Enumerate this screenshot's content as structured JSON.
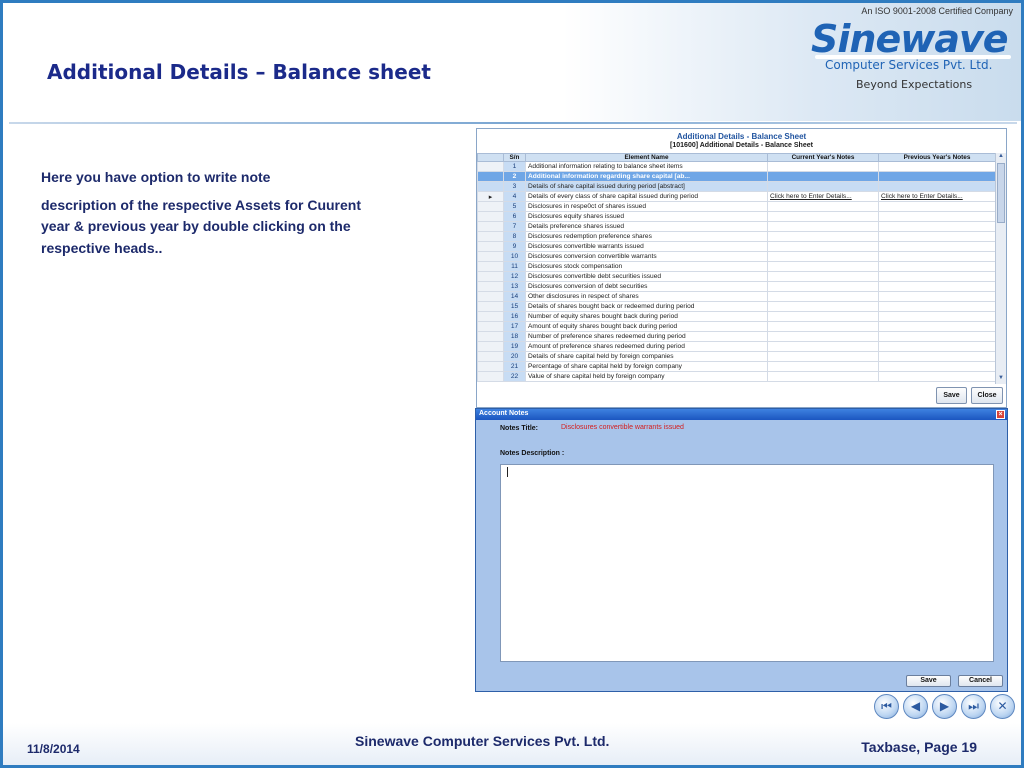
{
  "header": {
    "title": "Additional Details – Balance sheet",
    "iso": "An ISO 9001-2008 Certified Company",
    "logo_word": "Sinewave",
    "logo_sub": "Computer Services Pvt. Ltd.",
    "logo_tag": "Beyond Expectations"
  },
  "description": {
    "line1": "Here you have  option to write note",
    "line2": "description of the respective Assets for Cuurent year & previous year by double clicking on the respective heads.."
  },
  "grid_window": {
    "title": "Additional Details -  Balance Sheet",
    "subtitle": "[101600] Additional Details -  Balance Sheet",
    "columns": [
      "S/n",
      "Element Name",
      "Current Year's Notes",
      "Previous Year's Notes"
    ],
    "rows": [
      {
        "sn": "1",
        "name": "Additional information relating to balance sheet items",
        "cur": "",
        "prev": ""
      },
      {
        "sn": "2",
        "name": "Additional information regarding share capital [ab...",
        "cur": "",
        "prev": ""
      },
      {
        "sn": "3",
        "name": "Details of share capital issued during period [abstract]",
        "cur": "",
        "prev": ""
      },
      {
        "sn": "4",
        "name": "Details of every class of share capital issued during period",
        "cur": "Click here to Enter Details...",
        "prev": "Click here to Enter Details..."
      },
      {
        "sn": "5",
        "name": "Disclosures in respe0ct of shares issued",
        "cur": "",
        "prev": ""
      },
      {
        "sn": "6",
        "name": "Disclosures equity shares issued",
        "cur": "",
        "prev": ""
      },
      {
        "sn": "7",
        "name": "Details preference shares issued",
        "cur": "",
        "prev": ""
      },
      {
        "sn": "8",
        "name": "Disclosures redemption preference shares",
        "cur": "",
        "prev": ""
      },
      {
        "sn": "9",
        "name": "Disclosures convertible warrants issued",
        "cur": "",
        "prev": ""
      },
      {
        "sn": "10",
        "name": "Disclosures conversion convertible warrants",
        "cur": "",
        "prev": ""
      },
      {
        "sn": "11",
        "name": "Disclosures stock compensation",
        "cur": "",
        "prev": ""
      },
      {
        "sn": "12",
        "name": "Disclosures convertible debt securities issued",
        "cur": "",
        "prev": ""
      },
      {
        "sn": "13",
        "name": "Disclosures conversion of debt securities",
        "cur": "",
        "prev": ""
      },
      {
        "sn": "14",
        "name": "Other disclosures in respect of shares",
        "cur": "",
        "prev": ""
      },
      {
        "sn": "15",
        "name": "Details of shares bought back or redeemed during period",
        "cur": "",
        "prev": ""
      },
      {
        "sn": "16",
        "name": "Number of equity shares bought back during period",
        "cur": "",
        "prev": ""
      },
      {
        "sn": "17",
        "name": "Amount of equity shares bought back during period",
        "cur": "",
        "prev": ""
      },
      {
        "sn": "18",
        "name": "Number of preference shares redeemed during period",
        "cur": "",
        "prev": ""
      },
      {
        "sn": "19",
        "name": "Amount of preference shares redeemed during period",
        "cur": "",
        "prev": ""
      },
      {
        "sn": "20",
        "name": "Details of share capital held by foreign companies",
        "cur": "",
        "prev": ""
      },
      {
        "sn": "21",
        "name": "Percentage of share capital held by foreign company",
        "cur": "",
        "prev": ""
      },
      {
        "sn": "22",
        "name": "Value of share capital held by foreign company",
        "cur": "",
        "prev": ""
      }
    ],
    "save_label": "Save",
    "close_label": "Close"
  },
  "notes_dialog": {
    "title": "Account Notes",
    "notes_title_label": "Notes Title:",
    "notes_title_value": "Disclosures convertible warrants issued",
    "notes_desc_label": "Notes Description :",
    "save_label": "Save",
    "cancel_label": "Cancel"
  },
  "footer": {
    "date": "11/8/2014",
    "company": "Sinewave Computer Services Pvt. Ltd.",
    "page": "Taxbase, Page 19"
  },
  "nav_icons": [
    "first-slide-icon",
    "previous-slide-icon",
    "next-slide-icon",
    "last-slide-icon",
    "close-icon"
  ]
}
